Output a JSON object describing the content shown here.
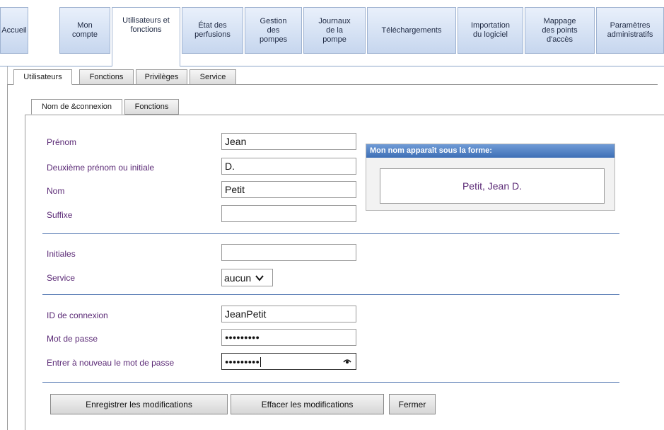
{
  "nav": {
    "tabs": [
      {
        "label": "Accueil"
      },
      {
        "label": "Mon compte"
      },
      {
        "label": "Utilisateurs et fonctions"
      },
      {
        "label": "État des perfusions"
      },
      {
        "label": "Gestion des pompes"
      },
      {
        "label": "Journaux de la pompe"
      },
      {
        "label": "Téléchargements"
      },
      {
        "label": "Importation du logiciel"
      },
      {
        "label": "Mappage des points d'accès"
      },
      {
        "label": "Paramètres administratifs"
      }
    ],
    "active": "Utilisateurs et fonctions"
  },
  "subtabs": [
    {
      "label": "Utilisateurs"
    },
    {
      "label": "Fonctions"
    },
    {
      "label": "Privilèges"
    },
    {
      "label": "Service"
    }
  ],
  "innertabs": [
    {
      "label": "Nom de &connexion"
    },
    {
      "label": "Fonctions"
    }
  ],
  "form": {
    "first_name": {
      "label": "Prénom",
      "value": "Jean"
    },
    "middle_name": {
      "label": "Deuxième prénom ou initiale",
      "value": "D."
    },
    "last_name": {
      "label": "Nom",
      "value": "Petit"
    },
    "suffix": {
      "label": "Suffixe",
      "value": ""
    },
    "initials": {
      "label": "Initiales",
      "value": ""
    },
    "service": {
      "label": "Service",
      "value": "aucun"
    },
    "login_id": {
      "label": "ID de connexion",
      "value": "JeanPetit"
    },
    "password": {
      "label": "Mot de passe",
      "mask": "●●●●●●●●●"
    },
    "password_confirm": {
      "label": "Entrer à nouveau le mot de passe",
      "mask": "●●●●●●●●●"
    }
  },
  "display_name": {
    "header": "Mon nom apparaît sous la forme:",
    "value": "Petit, Jean D."
  },
  "buttons": {
    "save": "Enregistrer les modifications",
    "clear": "Effacer les modifications",
    "close": "Fermer"
  },
  "icons": {
    "chevron": "chevron-down-icon",
    "eye": "eye-icon"
  },
  "colors": {
    "label": "#5b2a76",
    "divider": "#5a7db5",
    "header_blue": "#3e6fb6"
  }
}
